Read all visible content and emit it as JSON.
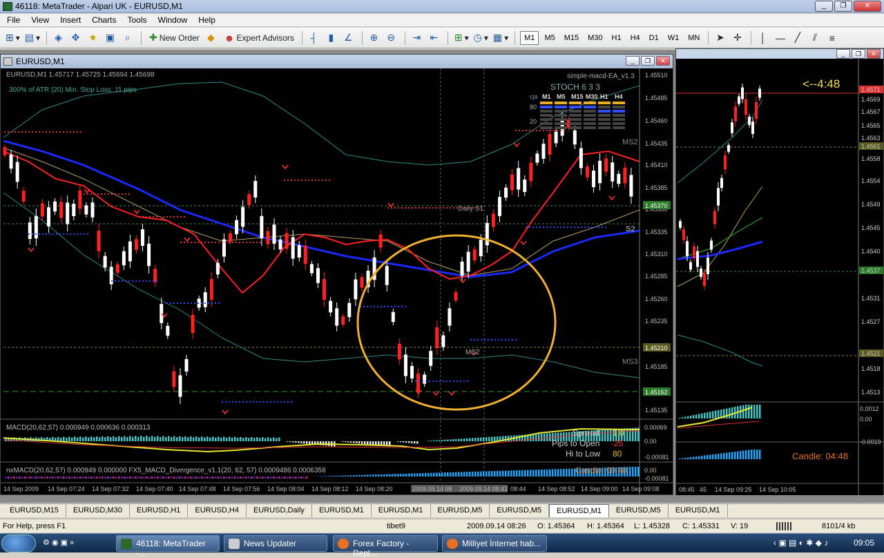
{
  "app": {
    "title": "46118: MetaTrader - Alpari UK - EURUSD,M1"
  },
  "menu": [
    "File",
    "View",
    "Insert",
    "Charts",
    "Tools",
    "Window",
    "Help"
  ],
  "toolbar": {
    "new_order": "New Order",
    "expert_advisors": "Expert Advisors",
    "timeframes": [
      "M1",
      "M5",
      "M15",
      "M30",
      "H1",
      "H4",
      "D1",
      "W1",
      "MN"
    ],
    "active_tf": "M1"
  },
  "main_chart": {
    "window_title": "EURUSD,M1",
    "info": "EURUSD,M1  1.45717 1.45725 1.45694 1.45698",
    "atr_line": "300% of ATR (20)     Min. Stop Loss:    11 pips",
    "ea_name": "simple-macd-EA_v1.3",
    "stoch_title": "STOCH 6 3 3",
    "stoch_prefix": "cja",
    "stoch_tfs": [
      "M1",
      "M5",
      "M15",
      "M30",
      "H1",
      "H4"
    ],
    "stoch_levels": [
      "80",
      "20"
    ],
    "labels": {
      "daily_s1": "Daily S1",
      "s2": "S2",
      "ms2_top": "MS2",
      "ms2_mid": "MS2",
      "ms3": "MS3"
    },
    "price_ticks": [
      "1.45510",
      "1.45485",
      "1.45460",
      "1.45435",
      "1.45410",
      "1.45385",
      "1.45360",
      "1.45335",
      "1.45310",
      "1.45285",
      "1.45260",
      "1.45235",
      "1.45185",
      "1.45135"
    ],
    "price_badges": [
      {
        "text": "1.45370",
        "color": "#2a7a2a"
      },
      {
        "text": "1.45210",
        "color": "#5a5a20"
      },
      {
        "text": "1.45162",
        "color": "#2a7a2a"
      }
    ],
    "macd": {
      "title": "MACD(20,62,57) 0.000949 0.000636 0.000313",
      "ticks": [
        "0.00069",
        "0.00",
        "-0.00081"
      ]
    },
    "nxmacd": {
      "title": "nxMACD(20,62,57) 0.000949 0.000000  FX5_MACD_Divergence_v1.1(20, 62, 57) 0.0009486 0.0006358",
      "ticks": [
        "0.00",
        "-0.00081"
      ]
    },
    "info_box": {
      "spread_label": "Spread",
      "spread_val": "1.0",
      "pips_label": "Pips to Open",
      "pips_val": "-25",
      "hl_label": "Hi to Low",
      "hl_val": "80",
      "candle": "Candle: 00:48"
    },
    "time_axis": [
      "14 Sep 2009",
      "14 Sep 07:24",
      "14 Sep 07:32",
      "14 Sep 07:40",
      "14 Sep 07:48",
      "14 Sep 07:56",
      "14 Sep 08:04",
      "14 Sep 08:12",
      "14 Sep 08:20",
      "2009.09.14 08",
      "2009.09.14 08:43",
      "08:44",
      "14 Sep 08:52",
      "14 Sep 09:00",
      "14 Sep 09:08"
    ]
  },
  "side_chart": {
    "countdown": "<--4:48",
    "candle": "Candle:  04:48",
    "ticks": [
      "1.4571",
      "1.4569",
      "1.4567",
      "1.4565",
      "1.4563",
      "1.4561",
      "1.4558",
      "1.4554",
      "1.4549",
      "1.4545",
      "1.4540",
      "1.4537",
      "1.4531",
      "1.4527",
      "1.4521",
      "1.4518",
      "1.4513"
    ],
    "macd_ticks": [
      "0.0012",
      "0.00",
      "-0.0019"
    ],
    "time_axis": [
      "08:45",
      "45",
      "14 Sep 09:25",
      "14 Sep 10:05"
    ]
  },
  "tabs": [
    "EURUSD,M15",
    "EURUSD,M30",
    "EURUSD,H1",
    "EURUSD,H4",
    "EURUSD,Daily",
    "EURUSD,M1",
    "EURUSD,M1",
    "EURUSD,M5",
    "EURUSD,M5",
    "EURUSD,M1",
    "EURUSD,M5",
    "EURUSD,M1"
  ],
  "active_tab": 9,
  "status": {
    "help": "For Help, press F1",
    "profile": "tibet9",
    "datetime": "2009.09.14 08:26",
    "open": "O: 1.45364",
    "high": "H: 1.45364",
    "low": "L: 1.45328",
    "close": "C: 1.45331",
    "volume": "V: 19",
    "traffic": "8101/4 kb"
  },
  "taskbar": {
    "items": [
      "46118: MetaTrader -...",
      "News Updater",
      "Forex Factory - Repl...",
      "Milliyet İnternet hab..."
    ],
    "clock": "09:05"
  },
  "colors": {
    "bull": "#ffffff",
    "bear": "#ff0000",
    "ema_red": "#ff2020",
    "ema_blue": "#1a2aff",
    "circle": "#f0b030"
  }
}
